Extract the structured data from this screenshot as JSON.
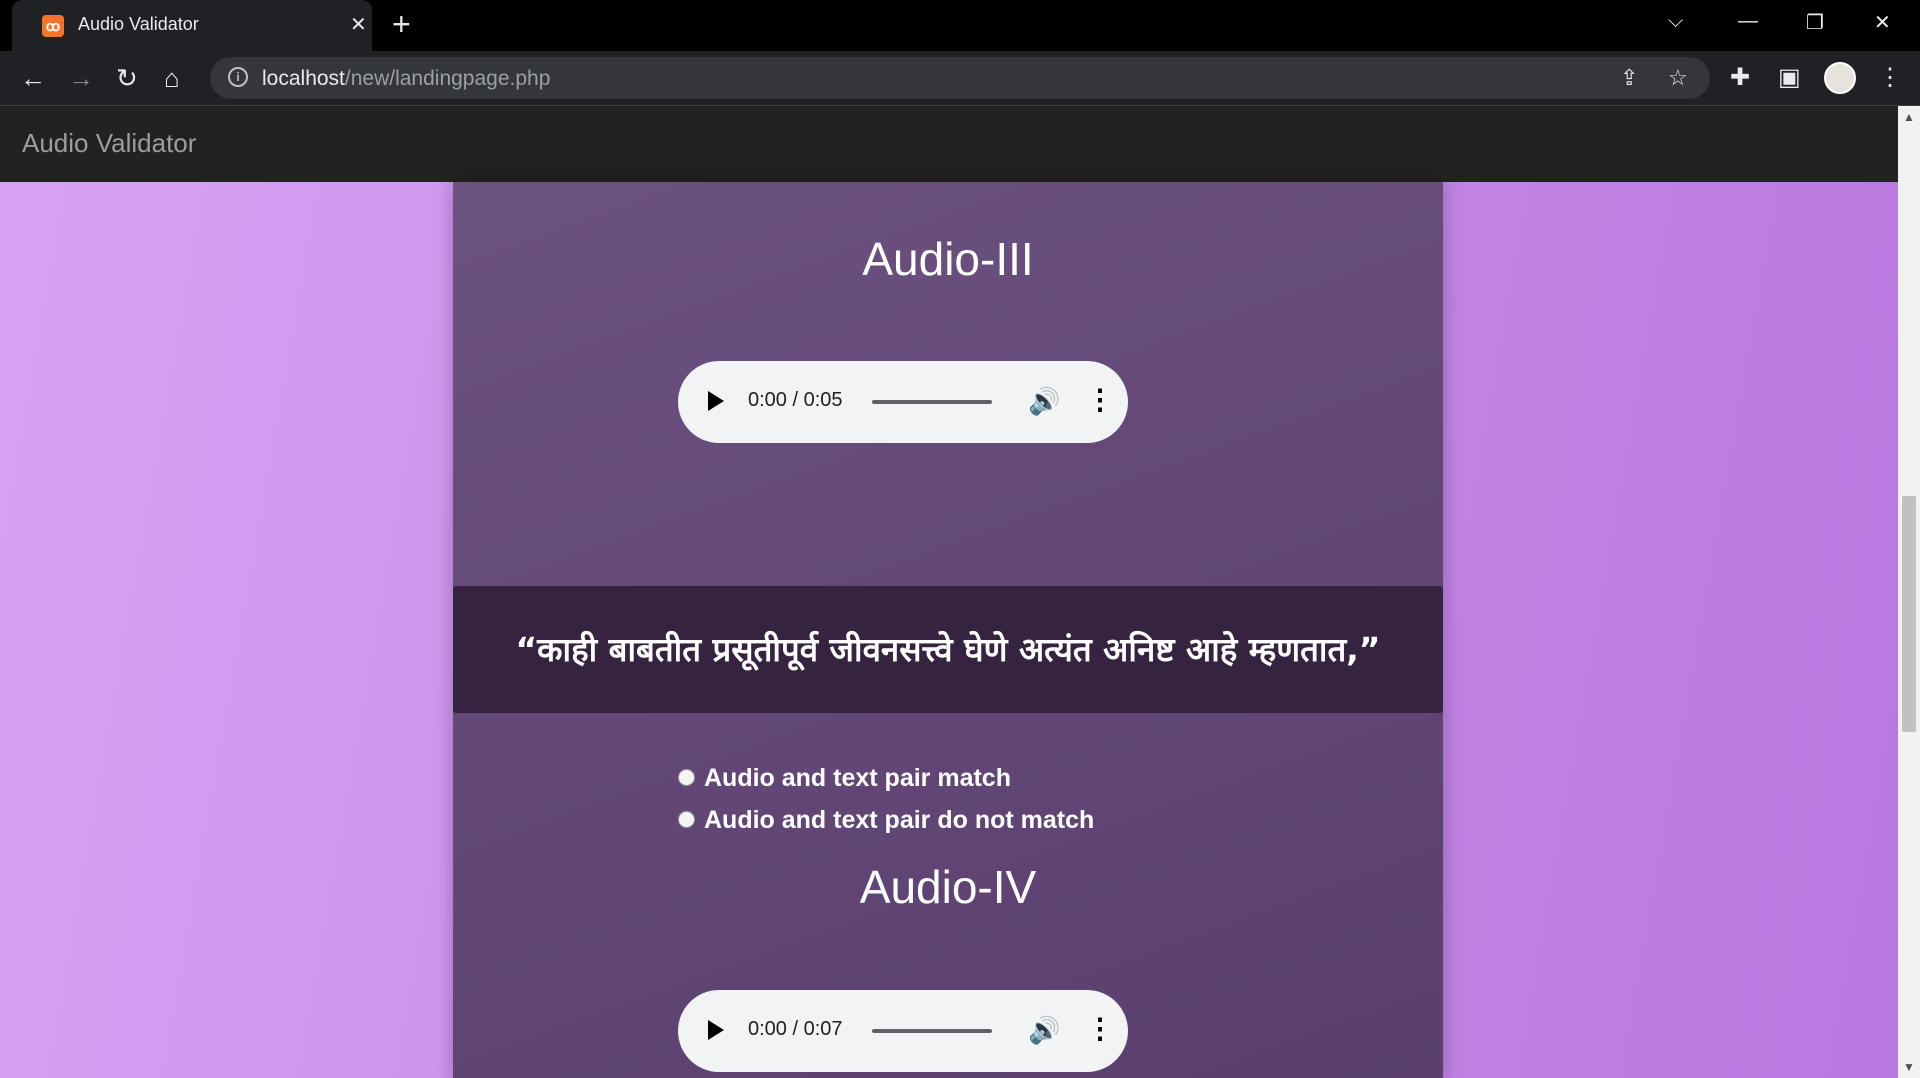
{
  "browser": {
    "tab_title": "Audio Validator",
    "favicon_text": "ꝏ",
    "url_host": "localhost",
    "url_path": "/new/landingpage.php"
  },
  "app": {
    "brand": "Audio Validator"
  },
  "audio_items": [
    {
      "heading": "Audio-III",
      "time": "0:00 / 0:05",
      "text": "“काही बाबतीत प्रसूतीपूर्व जीवनसत्त्वे घेणे अत्यंत अनिष्ट आहे म्हणतात,”",
      "options": [
        "Audio and text pair match",
        "Audio and text pair do not match"
      ]
    },
    {
      "heading": "Audio-IV",
      "time": "0:00 / 0:07"
    }
  ],
  "colors": {
    "page_gradient_start": "#d9a3f3",
    "page_gradient_end": "#b978de",
    "panel": "#654a79",
    "quote_box": "#35233f",
    "navbar": "#222222"
  },
  "icons": [
    "back-icon",
    "forward-icon",
    "reload-icon",
    "home-icon",
    "info-icon",
    "share-icon",
    "star-icon",
    "extensions-icon",
    "sidepanel-icon",
    "menu-icon",
    "play-icon",
    "volume-icon",
    "more-icon"
  ]
}
